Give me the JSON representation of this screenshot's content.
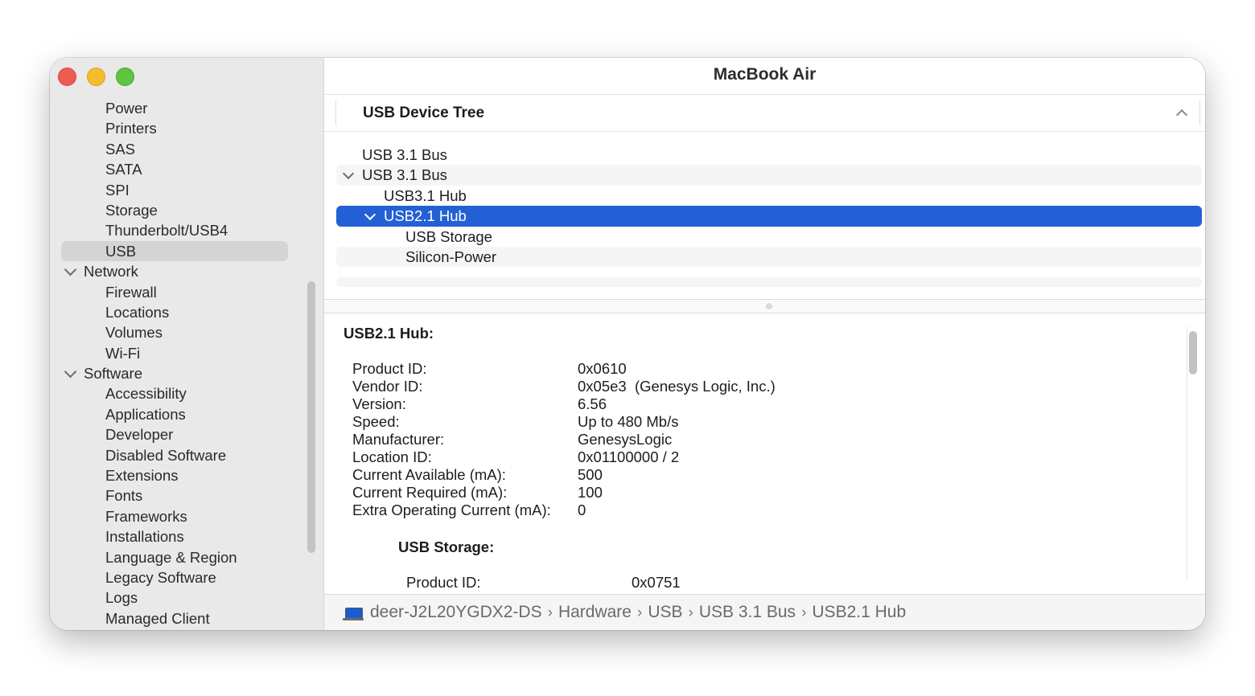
{
  "window": {
    "title": "MacBook Air"
  },
  "sidebar": {
    "items": [
      {
        "label": "Power",
        "level": 2
      },
      {
        "label": "Printers",
        "level": 2
      },
      {
        "label": "SAS",
        "level": 2
      },
      {
        "label": "SATA",
        "level": 2
      },
      {
        "label": "SPI",
        "level": 2
      },
      {
        "label": "Storage",
        "level": 2
      },
      {
        "label": "Thunderbolt/USB4",
        "level": 2
      },
      {
        "label": "USB",
        "level": 2,
        "selected": true
      },
      {
        "label": "Network",
        "level": 1,
        "expanded": true
      },
      {
        "label": "Firewall",
        "level": 2
      },
      {
        "label": "Locations",
        "level": 2
      },
      {
        "label": "Volumes",
        "level": 2
      },
      {
        "label": "Wi-Fi",
        "level": 2
      },
      {
        "label": "Software",
        "level": 1,
        "expanded": true
      },
      {
        "label": "Accessibility",
        "level": 2
      },
      {
        "label": "Applications",
        "level": 2
      },
      {
        "label": "Developer",
        "level": 2
      },
      {
        "label": "Disabled Software",
        "level": 2
      },
      {
        "label": "Extensions",
        "level": 2
      },
      {
        "label": "Fonts",
        "level": 2
      },
      {
        "label": "Frameworks",
        "level": 2
      },
      {
        "label": "Installations",
        "level": 2
      },
      {
        "label": "Language & Region",
        "level": 2
      },
      {
        "label": "Legacy Software",
        "level": 2
      },
      {
        "label": "Logs",
        "level": 2
      },
      {
        "label": "Managed Client",
        "level": 2
      }
    ]
  },
  "tree": {
    "title": "USB Device Tree",
    "rows": [
      {
        "label": "USB 3.1 Bus",
        "depth": 0
      },
      {
        "label": "USB 3.1 Bus",
        "depth": 0,
        "expanded": true
      },
      {
        "label": "USB3.1 Hub",
        "depth": 1
      },
      {
        "label": "USB2.1 Hub",
        "depth": 1,
        "expanded": true,
        "selected": true
      },
      {
        "label": "USB Storage",
        "depth": 2
      },
      {
        "label": "Silicon-Power",
        "depth": 2
      }
    ]
  },
  "detail": {
    "heading": "USB2.1 Hub:",
    "properties": [
      {
        "key": "Product ID:",
        "value": "0x0610"
      },
      {
        "key": "Vendor ID:",
        "value": "0x05e3  (Genesys Logic, Inc.)"
      },
      {
        "key": "Version:",
        "value": "6.56"
      },
      {
        "key": "Speed:",
        "value": "Up to 480 Mb/s"
      },
      {
        "key": "Manufacturer:",
        "value": "GenesysLogic"
      },
      {
        "key": "Location ID:",
        "value": "0x01100000 / 2"
      },
      {
        "key": "Current Available (mA):",
        "value": "500"
      },
      {
        "key": "Current Required (mA):",
        "value": "100"
      },
      {
        "key": "Extra Operating Current (mA):",
        "value": "0"
      }
    ],
    "sub_heading": "USB Storage:",
    "sub_properties": [
      {
        "key": "Product ID:",
        "value": "0x0751"
      }
    ]
  },
  "pathbar": {
    "crumbs": [
      "deer-J2L20YGDX2-DS",
      "Hardware",
      "USB",
      "USB 3.1 Bus",
      "USB2.1 Hub"
    ],
    "separator": "›"
  },
  "colors": {
    "selection": "#2360d6",
    "close": "#ee5b53",
    "minimize": "#f5bc2f",
    "zoom": "#5fc43f"
  }
}
